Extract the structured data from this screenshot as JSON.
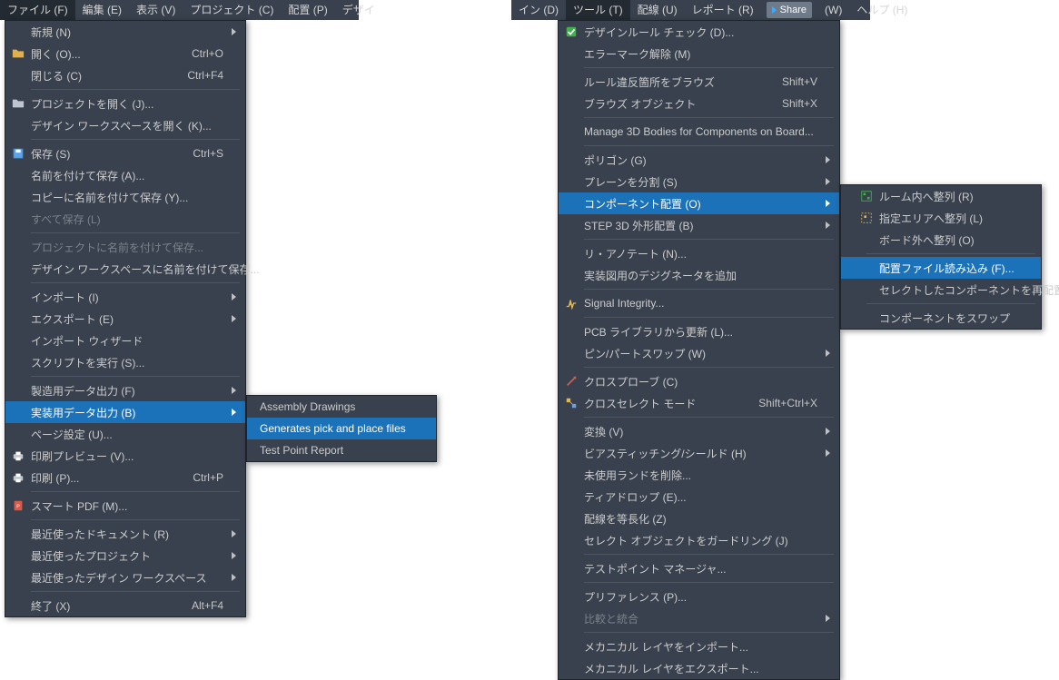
{
  "menubar_left": {
    "items": [
      {
        "label": "ファイル (F)",
        "active": true
      },
      {
        "label": "編集 (E)"
      },
      {
        "label": "表示 (V)"
      },
      {
        "label": "プロジェクト (C)"
      },
      {
        "label": "配置 (P)"
      },
      {
        "label": "デザイ"
      }
    ]
  },
  "menubar_right": {
    "items": [
      {
        "label": "イン (D)"
      },
      {
        "label": "ツール (T)",
        "active": true
      },
      {
        "label": "配線 (U)"
      },
      {
        "label": "レポート (R)"
      },
      {
        "label": "Share",
        "share": true
      },
      {
        "label": "(W)"
      },
      {
        "label": "ヘルプ (H)"
      }
    ]
  },
  "file_menu": [
    {
      "type": "item",
      "label": "新規 (N)",
      "submenu": true
    },
    {
      "type": "item",
      "label": "開く (O)...",
      "shortcut": "Ctrl+O",
      "icon": "folder"
    },
    {
      "type": "item",
      "label": "閉じる (C)",
      "shortcut": "Ctrl+F4"
    },
    {
      "type": "sep"
    },
    {
      "type": "item",
      "label": "プロジェクトを開く (J)...",
      "icon": "folder-proj"
    },
    {
      "type": "item",
      "label": "デザイン ワークスペースを開く (K)..."
    },
    {
      "type": "sep"
    },
    {
      "type": "item",
      "label": "保存 (S)",
      "shortcut": "Ctrl+S",
      "icon": "save"
    },
    {
      "type": "item",
      "label": "名前を付けて保存 (A)..."
    },
    {
      "type": "item",
      "label": "コピーに名前を付けて保存 (Y)..."
    },
    {
      "type": "item",
      "label": "すべて保存 (L)",
      "disabled": true
    },
    {
      "type": "sep"
    },
    {
      "type": "item",
      "label": "プロジェクトに名前を付けて保存...",
      "disabled": true
    },
    {
      "type": "item",
      "label": "デザイン ワークスペースに名前を付けて保存..."
    },
    {
      "type": "sep"
    },
    {
      "type": "item",
      "label": "インポート (I)",
      "submenu": true
    },
    {
      "type": "item",
      "label": "エクスポート (E)",
      "submenu": true
    },
    {
      "type": "item",
      "label": "インポート ウィザード"
    },
    {
      "type": "item",
      "label": "スクリプトを実行 (S)..."
    },
    {
      "type": "sep"
    },
    {
      "type": "item",
      "label": "製造用データ出力 (F)",
      "submenu": true
    },
    {
      "type": "item",
      "label": "実装用データ出力 (B)",
      "submenu": true,
      "highlight": true
    },
    {
      "type": "item",
      "label": "ページ設定 (U)..."
    },
    {
      "type": "item",
      "label": "印刷プレビュー (V)...",
      "icon": "print"
    },
    {
      "type": "item",
      "label": "印刷 (P)...",
      "shortcut": "Ctrl+P",
      "icon": "print"
    },
    {
      "type": "sep"
    },
    {
      "type": "item",
      "label": "スマート PDF (M)...",
      "icon": "pdf"
    },
    {
      "type": "sep"
    },
    {
      "type": "item",
      "label": "最近使ったドキュメント (R)",
      "submenu": true
    },
    {
      "type": "item",
      "label": "最近使ったプロジェクト",
      "submenu": true
    },
    {
      "type": "item",
      "label": "最近使ったデザイン ワークスペース",
      "submenu": true
    },
    {
      "type": "sep"
    },
    {
      "type": "item",
      "label": "終了 (X)",
      "shortcut": "Alt+F4"
    }
  ],
  "file_submenu": [
    {
      "label": "Assembly Drawings"
    },
    {
      "label": "Generates pick and place files",
      "highlight": true
    },
    {
      "label": "Test Point Report"
    }
  ],
  "tools_menu": [
    {
      "type": "item",
      "label": "デザインルール チェック (D)...",
      "icon": "drc"
    },
    {
      "type": "item",
      "label": "エラーマーク解除 (M)"
    },
    {
      "type": "sep"
    },
    {
      "type": "item",
      "label": "ルール違反箇所をブラウズ",
      "shortcut": "Shift+V"
    },
    {
      "type": "item",
      "label": "ブラウズ オブジェクト",
      "shortcut": "Shift+X"
    },
    {
      "type": "sep"
    },
    {
      "type": "item",
      "label": "Manage 3D Bodies for Components on Board..."
    },
    {
      "type": "sep"
    },
    {
      "type": "item",
      "label": "ポリゴン (G)",
      "submenu": true
    },
    {
      "type": "item",
      "label": "プレーンを分割 (S)",
      "submenu": true
    },
    {
      "type": "item",
      "label": "コンポーネント配置 (O)",
      "submenu": true,
      "highlight": true
    },
    {
      "type": "item",
      "label": "STEP 3D 外形配置 (B)",
      "submenu": true
    },
    {
      "type": "sep"
    },
    {
      "type": "item",
      "label": "リ・アノテート (N)..."
    },
    {
      "type": "item",
      "label": "実装図用のデジグネータを追加"
    },
    {
      "type": "sep"
    },
    {
      "type": "item",
      "label": "Signal Integrity...",
      "icon": "sig"
    },
    {
      "type": "sep"
    },
    {
      "type": "item",
      "label": "PCB ライブラリから更新 (L)..."
    },
    {
      "type": "item",
      "label": "ピン/パートスワップ (W)",
      "submenu": true
    },
    {
      "type": "sep"
    },
    {
      "type": "item",
      "label": "クロスプローブ (C)",
      "icon": "xprobe"
    },
    {
      "type": "item",
      "label": "クロスセレクト モード",
      "shortcut": "Shift+Ctrl+X",
      "icon": "xsel"
    },
    {
      "type": "sep"
    },
    {
      "type": "item",
      "label": "変換 (V)",
      "submenu": true
    },
    {
      "type": "item",
      "label": "ビアスティッチング/シールド (H)",
      "submenu": true
    },
    {
      "type": "item",
      "label": "未使用ランドを削除..."
    },
    {
      "type": "item",
      "label": "ティアドロップ (E)..."
    },
    {
      "type": "item",
      "label": "配線を等長化 (Z)"
    },
    {
      "type": "item",
      "label": "セレクト オブジェクトをガードリング (J)"
    },
    {
      "type": "sep"
    },
    {
      "type": "item",
      "label": "テストポイント マネージャ..."
    },
    {
      "type": "sep"
    },
    {
      "type": "item",
      "label": "プリファレンス (P)..."
    },
    {
      "type": "item",
      "label": "比較と統合",
      "disabled": true,
      "submenu": true
    },
    {
      "type": "sep"
    },
    {
      "type": "item",
      "label": "メカニカル レイヤをインポート..."
    },
    {
      "type": "item",
      "label": "メカニカル レイヤをエクスポート..."
    }
  ],
  "tools_submenu": [
    {
      "label": "ルーム内へ整列 (R)",
      "icon": "room1"
    },
    {
      "label": "指定エリアへ整列 (L)",
      "icon": "room2"
    },
    {
      "label": "ボード外へ整列 (O)"
    },
    {
      "type": "sep"
    },
    {
      "label": "配置ファイル読み込み (F)...",
      "highlight": true
    },
    {
      "label": "セレクトしたコンポーネントを再配置 (C)"
    },
    {
      "type": "sep"
    },
    {
      "label": "コンポーネントをスワップ"
    }
  ]
}
